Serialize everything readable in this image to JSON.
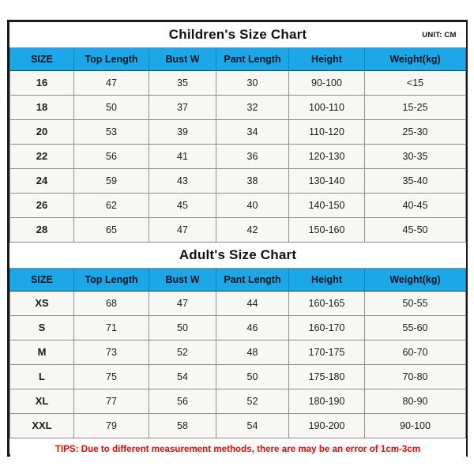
{
  "unit_label": "UNIT: CM",
  "columns": [
    "SIZE",
    "Top Length",
    "Bust W",
    "Pant Length",
    "Height",
    "Weight(kg)"
  ],
  "children": {
    "title": "Children's Size Chart",
    "headers": [
      "SIZE",
      "Top Length",
      "Bust W",
      "Pant Length",
      "Height",
      "Weight(kg)"
    ],
    "rows": [
      [
        "16",
        "47",
        "35",
        "30",
        "90-100",
        "<15"
      ],
      [
        "18",
        "50",
        "37",
        "32",
        "100-110",
        "15-25"
      ],
      [
        "20",
        "53",
        "39",
        "34",
        "110-120",
        "25-30"
      ],
      [
        "22",
        "56",
        "41",
        "36",
        "120-130",
        "30-35"
      ],
      [
        "24",
        "59",
        "43",
        "38",
        "130-140",
        "35-40"
      ],
      [
        "26",
        "62",
        "45",
        "40",
        "140-150",
        "40-45"
      ],
      [
        "28",
        "65",
        "47",
        "42",
        "150-160",
        "45-50"
      ]
    ]
  },
  "adult": {
    "title": "Adult's Size Chart",
    "headers": [
      "SIZE",
      "Top Length",
      "Bust W",
      "Pant Length",
      "Height",
      "Weight(kg)"
    ],
    "rows": [
      [
        "XS",
        "68",
        "47",
        "44",
        "160-165",
        "50-55"
      ],
      [
        "S",
        "71",
        "50",
        "46",
        "160-170",
        "55-60"
      ],
      [
        "M",
        "73",
        "52",
        "48",
        "170-175",
        "60-70"
      ],
      [
        "L",
        "75",
        "54",
        "50",
        "175-180",
        "70-80"
      ],
      [
        "XL",
        "77",
        "56",
        "52",
        "180-190",
        "80-90"
      ],
      [
        "XXL",
        "79",
        "58",
        "54",
        "190-200",
        "90-100"
      ]
    ]
  },
  "tips": "TIPS: Due to different measurement methods, there are may be an error of 1cm-3cm",
  "colors": {
    "header_blue": "#1CA7E8",
    "tips_red": "#ff0000",
    "frame_border": "#1a1a1a",
    "cell_background": "#f7f7f5",
    "grid_line": "#8e8e8e"
  }
}
